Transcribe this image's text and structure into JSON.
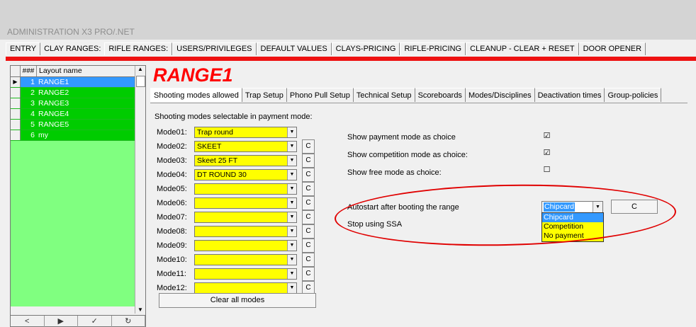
{
  "app": {
    "title": "ADMINISTRATION X3 PRO/.NET"
  },
  "main_tabs": [
    {
      "label": "ENTRY"
    },
    {
      "label": "CLAY RANGES:"
    },
    {
      "label": "RIFLE RANGES:"
    },
    {
      "label": "USERS/PRIVILEGES"
    },
    {
      "label": "DEFAULT VALUES"
    },
    {
      "label": "CLAYS-PRICING"
    },
    {
      "label": "RIFLE-PRICING"
    },
    {
      "label": "CLEANUP - CLEAR + RESET"
    },
    {
      "label": "DOOR OPENER"
    }
  ],
  "layout_grid": {
    "header_num": "###",
    "header_name": "Layout name",
    "rows": [
      {
        "num": "1",
        "name": "RANGE1"
      },
      {
        "num": "2",
        "name": "RANGE2"
      },
      {
        "num": "3",
        "name": "RANGE3"
      },
      {
        "num": "4",
        "name": "RANGE4"
      },
      {
        "num": "5",
        "name": "RANGE5"
      },
      {
        "num": "6",
        "name": "my"
      }
    ]
  },
  "range": {
    "title": "RANGE1"
  },
  "sub_tabs": [
    {
      "label": "Shooting modes allowed"
    },
    {
      "label": "Trap Setup"
    },
    {
      "label": "Phono Pull Setup"
    },
    {
      "label": "Technical Setup"
    },
    {
      "label": "Scoreboards"
    },
    {
      "label": "Modes/Disciplines"
    },
    {
      "label": "Deactivation times"
    },
    {
      "label": "Group-policies"
    }
  ],
  "modes": {
    "heading": "Shooting modes selectable in payment mode:",
    "items": [
      {
        "label": "Mode01:",
        "value": "Trap round"
      },
      {
        "label": "Mode02:",
        "value": "SKEET"
      },
      {
        "label": "Mode03:",
        "value": "Skeet 25 FT"
      },
      {
        "label": "Mode04:",
        "value": "DT ROUND 30"
      },
      {
        "label": "Mode05:",
        "value": ""
      },
      {
        "label": "Mode06:",
        "value": ""
      },
      {
        "label": "Mode07:",
        "value": ""
      },
      {
        "label": "Mode08:",
        "value": ""
      },
      {
        "label": "Mode09:",
        "value": ""
      },
      {
        "label": "Mode10:",
        "value": ""
      },
      {
        "label": "Mode11:",
        "value": ""
      },
      {
        "label": "Mode12:",
        "value": ""
      }
    ],
    "c_label": "C",
    "clear_label": "Clear all modes"
  },
  "options": {
    "show_payment": {
      "label": "Show payment mode as choice",
      "checked": true
    },
    "show_competition": {
      "label": "Show competition mode as choice:",
      "checked": true
    },
    "show_free": {
      "label": "Show free mode as choice:",
      "checked": false
    },
    "autostart": {
      "label": "Autostart after booting the range",
      "value": "Chipcard",
      "c_label": "C"
    },
    "stop_ssa": {
      "label": "Stop using SSA"
    },
    "autostart_options": [
      "Chipcard",
      "Competition",
      "No payment"
    ]
  },
  "colors": {
    "accent_red": "#ee1111",
    "grid_green": "#80ff80",
    "row_green": "#00cc00",
    "selection_blue": "#3399ff",
    "field_yellow": "#ffff00"
  }
}
